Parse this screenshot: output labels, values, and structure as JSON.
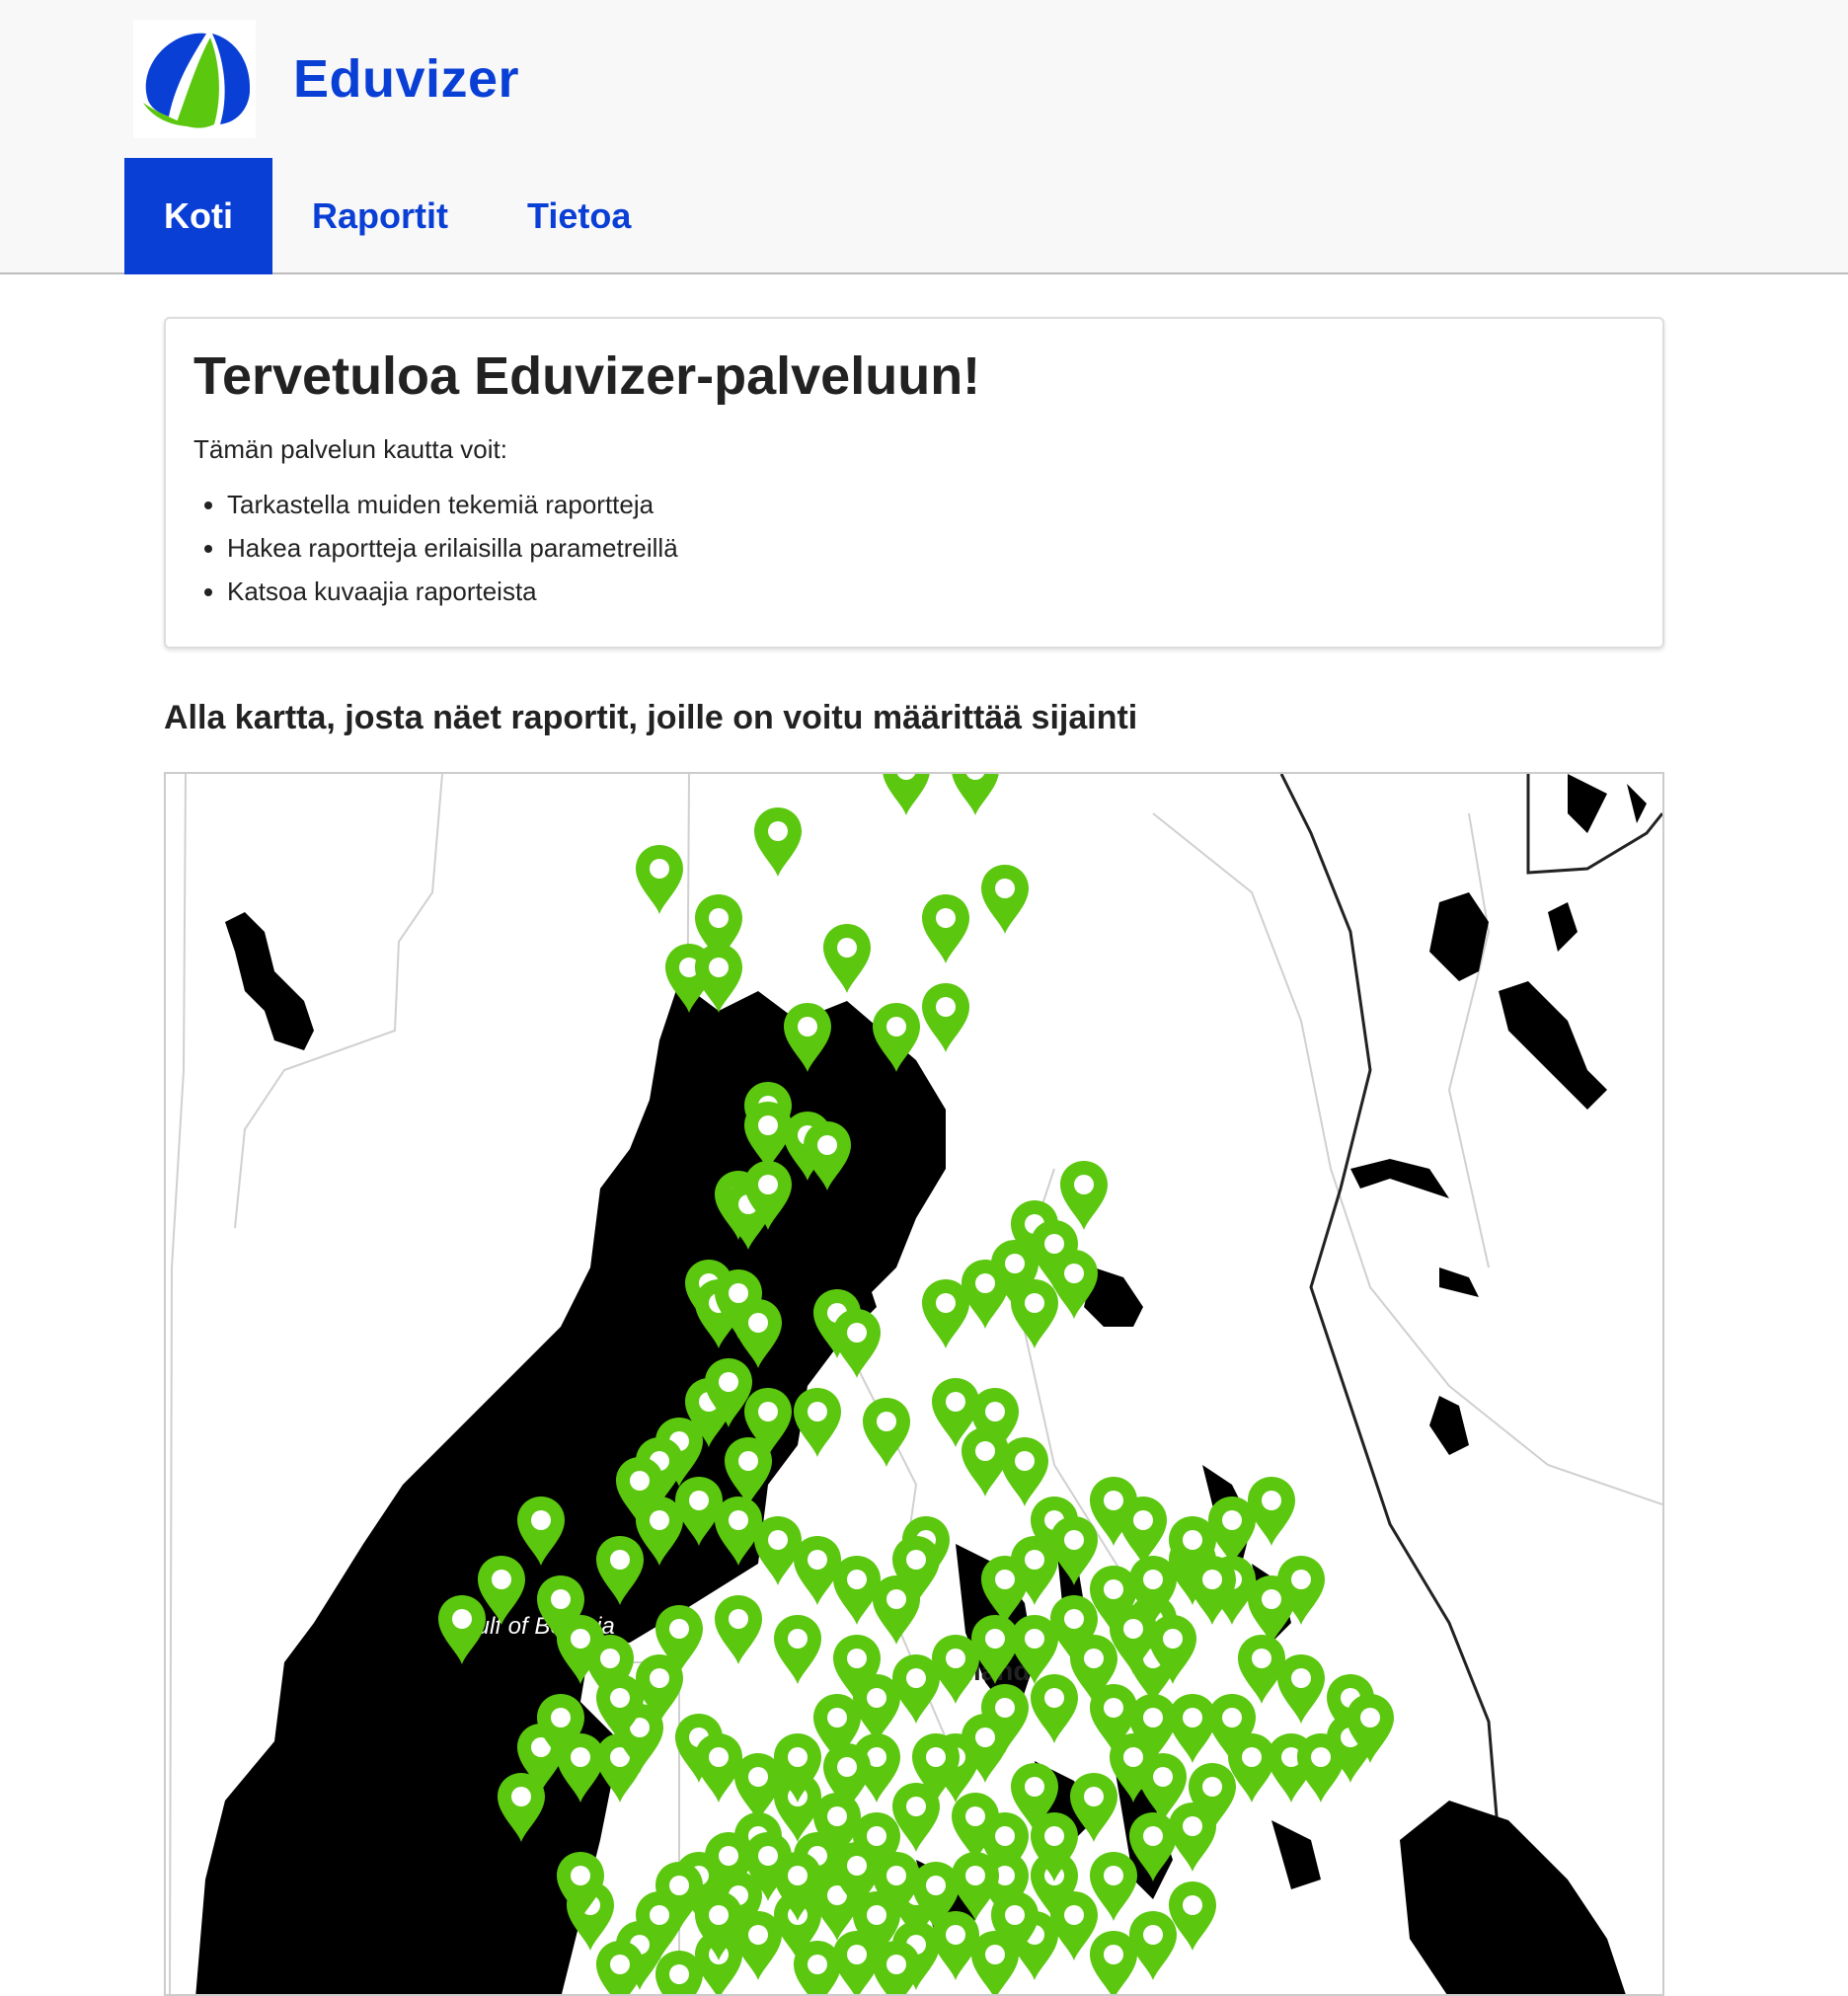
{
  "app": {
    "brand_name": "Eduvizer",
    "logo_icon": "eduvizer-logo",
    "accent_color": "#0a3fd6",
    "logo_colors": [
      "#0a3fd6",
      "#5bc70f"
    ]
  },
  "nav": {
    "items": [
      {
        "label": "Koti",
        "active": true
      },
      {
        "label": "Raportit",
        "active": false
      },
      {
        "label": "Tietoa",
        "active": false
      }
    ]
  },
  "welcome": {
    "title": "Tervetuloa Eduvizer-palveluun!",
    "intro": "Tämän palvelun kautta voit:",
    "bullets": [
      "Tarkastella muiden tekemiä raportteja",
      "Hakea raportteja erilaisilla parametreillä",
      "Katsoa kuvaajia raporteista"
    ]
  },
  "map": {
    "heading": "Alla kartta, josta näet raportit, joille on voitu määrittää sijainti",
    "labels": {
      "gulf": "Gulf of Bothnia",
      "country": "Finland"
    },
    "marker_color": "#5bc70f",
    "marker_icon": "map-marker-icon"
  }
}
